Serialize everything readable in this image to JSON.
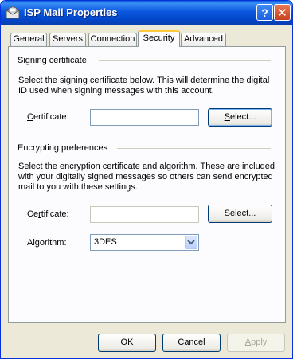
{
  "window": {
    "title": "ISP Mail Properties",
    "help_label": "?",
    "close_label": "✕"
  },
  "tabs": [
    {
      "label": "General"
    },
    {
      "label": "Servers"
    },
    {
      "label": "Connection"
    },
    {
      "label": "Security",
      "active": true
    },
    {
      "label": "Advanced"
    }
  ],
  "signing": {
    "title": "Signing certificate",
    "description": "Select the signing certificate below. This will determine the digital ID used when signing messages with this account.",
    "certificate_label_u": "C",
    "certificate_label_rest": "ertificate:",
    "certificate_value": "",
    "select_u": "S",
    "select_rest": "elect..."
  },
  "encrypting": {
    "title": "Encrypting preferences",
    "description": "Select the encryption certificate and algorithm. These are included with your digitally signed messages so others can send encrypted mail to you with these settings.",
    "certificate_label_pre": "Ce",
    "certificate_label_u": "r",
    "certificate_label_rest": "tificate:",
    "certificate_value": "",
    "select_pre": "Sel",
    "select_u": "e",
    "select_rest": "ct...",
    "algorithm_label": "Algorithm:",
    "algorithm_value": "3DES"
  },
  "footer": {
    "ok": "OK",
    "cancel": "Cancel",
    "apply_u": "A",
    "apply_rest": "pply"
  },
  "colors": {
    "titlebar": "#0a57e0",
    "dialog": "#ece9d8",
    "panel": "#fcfcfe",
    "active_tab_accent": "#ffc83c"
  }
}
